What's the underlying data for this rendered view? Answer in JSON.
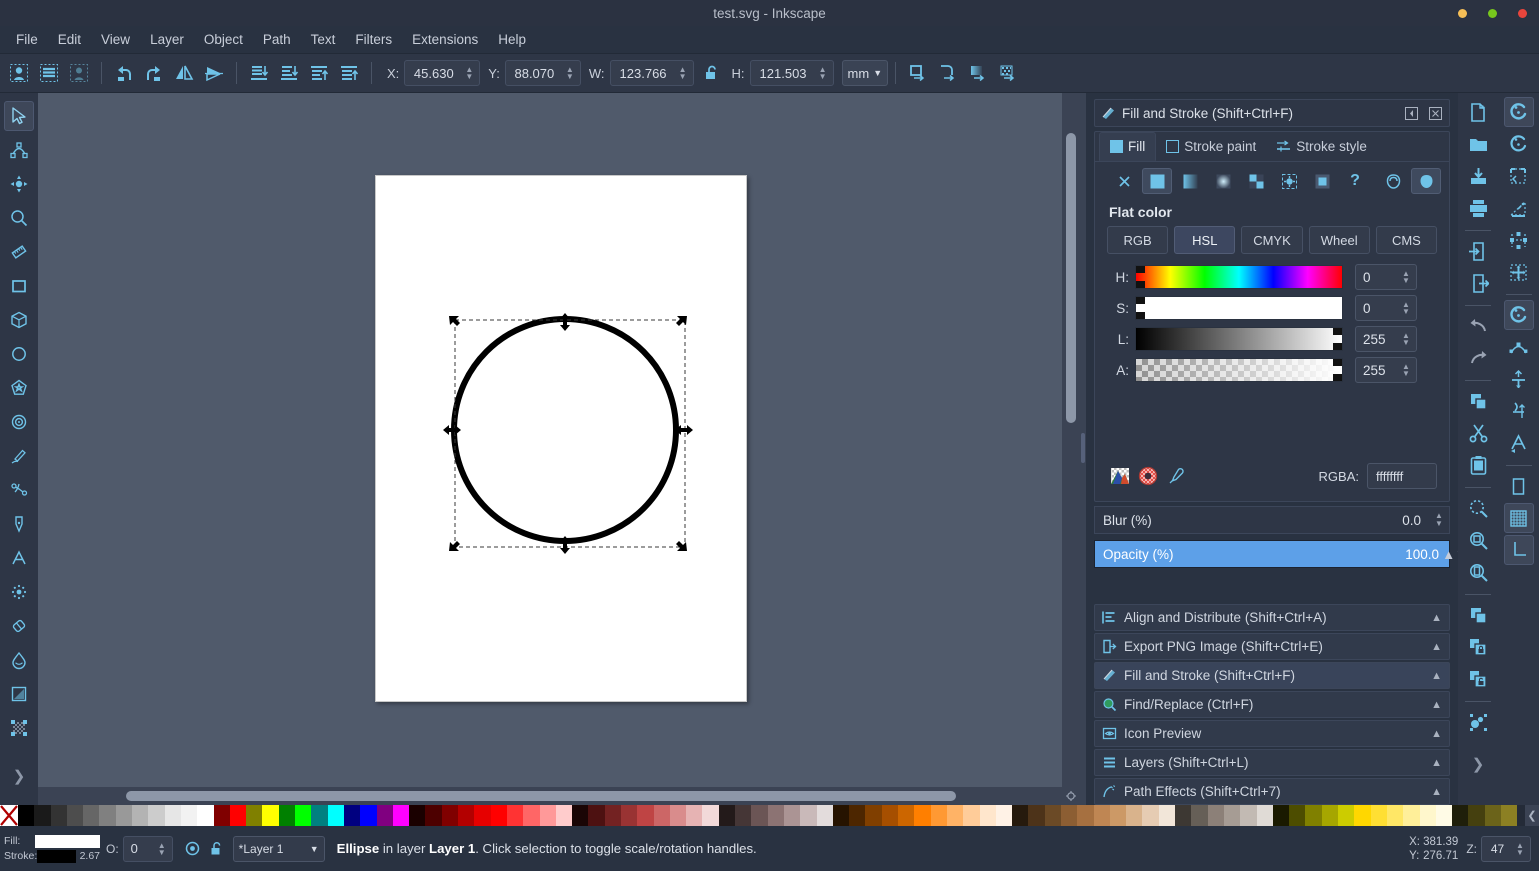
{
  "window": {
    "title": "test.svg - Inkscape",
    "controls": [
      {
        "name": "minimize",
        "color": "#f6bf57"
      },
      {
        "name": "maximize",
        "color": "#78c71d"
      },
      {
        "name": "close",
        "color": "#e8453c"
      }
    ]
  },
  "menubar": [
    "File",
    "Edit",
    "View",
    "Layer",
    "Object",
    "Path",
    "Text",
    "Filters",
    "Extensions",
    "Help"
  ],
  "tooloptions": {
    "buttons": [
      "select-all-icon",
      "select-all-layers-icon",
      "deselect-icon",
      "rotate-ccw-icon",
      "rotate-cw-icon",
      "flip-horizontal-icon",
      "flip-vertical-icon",
      "lower-to-bottom-icon",
      "lower-icon",
      "raise-icon",
      "raise-to-top-icon"
    ],
    "x_label": "X:",
    "x_value": "45.630",
    "y_label": "Y:",
    "y_value": "88.070",
    "w_label": "W:",
    "w_value": "123.766",
    "lock_icon": "unlocked-icon",
    "h_label": "H:",
    "h_value": "121.503",
    "units": "mm",
    "affect_buttons": [
      "scale-stroke-icon",
      "scale-corners-icon",
      "transform-gradients-icon",
      "transform-patterns-icon"
    ]
  },
  "toolbox": [
    {
      "name": "selector-tool",
      "icon": "arrow-cursor-icon",
      "active": true
    },
    {
      "name": "node-tool",
      "icon": "node-editor-icon",
      "active": false
    },
    {
      "name": "tweak-tool",
      "icon": "move-arrows-icon",
      "active": false
    },
    {
      "name": "zoom-tool",
      "icon": "magnifier-icon",
      "active": false
    },
    {
      "name": "measure-tool",
      "icon": "ruler-icon",
      "active": false
    },
    {
      "name": "rectangle-tool",
      "icon": "square-icon",
      "active": false
    },
    {
      "name": "box3d-tool",
      "icon": "cube-icon",
      "active": false
    },
    {
      "name": "ellipse-tool",
      "icon": "circle-icon",
      "active": false
    },
    {
      "name": "star-tool",
      "icon": "star-icon",
      "active": false
    },
    {
      "name": "spiral-tool",
      "icon": "spiral-icon",
      "active": false
    },
    {
      "name": "pencil-tool",
      "icon": "pencil-icon",
      "active": false
    },
    {
      "name": "calligraphy-tool",
      "icon": "calligraphy-icon",
      "active": false
    },
    {
      "name": "pen-tool",
      "icon": "pen-nib-icon",
      "active": false
    },
    {
      "name": "text-tool",
      "icon": "letter-a-icon",
      "active": false
    },
    {
      "name": "spray-tool",
      "icon": "spray-dots-icon",
      "active": false
    },
    {
      "name": "eraser-tool",
      "icon": "eraser-icon",
      "active": false
    },
    {
      "name": "paint-bucket-tool",
      "icon": "droplet-icon",
      "active": false
    },
    {
      "name": "gradient-tool",
      "icon": "gradient-square-icon",
      "active": false
    },
    {
      "name": "mesh-gradient-tool",
      "icon": "mesh-grid-icon",
      "active": false
    },
    {
      "name": "toolbox-overflow",
      "icon": "chevron-right-icon",
      "active": false
    }
  ],
  "canvas": {
    "page_label": "drawing-page",
    "object": "ellipse"
  },
  "dock": {
    "panel": {
      "title": "Fill and Stroke (Shift+Ctrl+F)",
      "collapse_icon": "collapse-icon",
      "close_icon": "close-icon"
    },
    "tabs": [
      {
        "label": "Fill",
        "icon": "fill-square-icon",
        "active": true
      },
      {
        "label": "Stroke paint",
        "icon": "stroke-square-icon",
        "active": false
      },
      {
        "label": "Stroke style",
        "icon": "stroke-style-icon",
        "active": false
      }
    ],
    "paint_types": [
      {
        "name": "no-paint",
        "icon": "x-icon",
        "selected": false
      },
      {
        "name": "flat-color",
        "icon": "flat-square-icon",
        "selected": true
      },
      {
        "name": "linear-gradient",
        "icon": "linear-gradient-icon",
        "selected": false
      },
      {
        "name": "radial-gradient",
        "icon": "radial-gradient-icon",
        "selected": false
      },
      {
        "name": "pattern",
        "icon": "checker-pattern-icon",
        "selected": false
      },
      {
        "name": "swatch",
        "icon": "swatch-icon",
        "selected": false
      },
      {
        "name": "mesh-gradient",
        "icon": "mesh-gradient-icon",
        "selected": false
      },
      {
        "name": "unknown-paint",
        "icon": "question-mark-icon",
        "selected": false
      }
    ],
    "fill_rules": [
      {
        "name": "even-odd-fill-rule",
        "icon": "evenodd-icon",
        "selected": false
      },
      {
        "name": "nonzero-fill-rule",
        "icon": "nonzero-icon",
        "selected": true
      }
    ],
    "flat_color_label": "Flat color",
    "color_modes": [
      {
        "label": "RGB",
        "active": false
      },
      {
        "label": "HSL",
        "active": true
      },
      {
        "label": "CMYK",
        "active": false
      },
      {
        "label": "Wheel",
        "active": false
      },
      {
        "label": "CMS",
        "active": false
      }
    ],
    "sliders": [
      {
        "label": "H:",
        "value": "0",
        "track": "hue"
      },
      {
        "label": "S:",
        "value": "0",
        "track": "saturation"
      },
      {
        "label": "L:",
        "value": "255",
        "track": "lightness"
      },
      {
        "label": "A:",
        "value": "255",
        "track": "alpha"
      }
    ],
    "rgba": {
      "label": "RGBA:",
      "value": "ffffffff",
      "buttons": [
        "color-managed-icon",
        "out-of-gamut-icon",
        "eyedropper-icon"
      ]
    },
    "blur": {
      "label": "Blur (%)",
      "value": "0.0"
    },
    "opacity": {
      "label": "Opacity (%)",
      "value": "100.0"
    },
    "items": [
      {
        "label": "Align and Distribute (Shift+Ctrl+A)",
        "icon": "align-icon",
        "selected": false
      },
      {
        "label": "Export PNG Image (Shift+Ctrl+E)",
        "icon": "export-icon",
        "selected": false
      },
      {
        "label": "Fill and Stroke (Shift+Ctrl+F)",
        "icon": "fill-stroke-icon",
        "selected": true
      },
      {
        "label": "Find/Replace (Ctrl+F)",
        "icon": "find-icon",
        "selected": false
      },
      {
        "label": "Icon Preview",
        "icon": "icon-preview-icon",
        "selected": false
      },
      {
        "label": "Layers (Shift+Ctrl+L)",
        "icon": "layers-icon",
        "selected": false
      },
      {
        "label": "Path Effects  (Shift+Ctrl+7)",
        "icon": "path-effects-icon",
        "selected": false
      }
    ]
  },
  "commandbar_left": [
    {
      "name": "new-document",
      "icon": "new-file-icon"
    },
    {
      "name": "open-document",
      "icon": "folder-icon"
    },
    {
      "name": "save-document",
      "icon": "save-icon"
    },
    {
      "name": "print-document",
      "icon": "printer-icon"
    },
    {
      "name": "import",
      "icon": "import-icon"
    },
    {
      "name": "export",
      "icon": "export-file-icon"
    },
    {
      "name": "undo",
      "icon": "undo-arrow-icon"
    },
    {
      "name": "redo",
      "icon": "redo-arrow-icon"
    },
    {
      "name": "copy",
      "icon": "copy-icon"
    },
    {
      "name": "cut",
      "icon": "scissors-icon"
    },
    {
      "name": "paste",
      "icon": "clipboard-icon"
    },
    {
      "name": "zoom-selection",
      "icon": "zoom-selection-icon"
    },
    {
      "name": "zoom-drawing",
      "icon": "zoom-drawing-icon"
    },
    {
      "name": "zoom-page",
      "icon": "zoom-page-icon"
    },
    {
      "name": "duplicate",
      "icon": "duplicate-icon"
    },
    {
      "name": "group",
      "icon": "group-lock-icon"
    },
    {
      "name": "ungroup",
      "icon": "ungroup-icon"
    },
    {
      "name": "xml-editor",
      "icon": "object-properties-icon"
    },
    {
      "name": "commandbar-overflow",
      "icon": "chevron-right-icon"
    }
  ],
  "commandbar_right": [
    {
      "name": "snap-enable",
      "icon": "snap-icon",
      "active": true
    },
    {
      "name": "snap-bounding-box",
      "icon": "snap-bbox-icon",
      "active": false
    },
    {
      "name": "snap-bbox-corner",
      "icon": "snap-corner-icon",
      "active": false
    },
    {
      "name": "snap-bbox-edge-midpoint",
      "icon": "snap-edge-mid-icon",
      "active": false
    },
    {
      "name": "snap-nodes",
      "icon": "snap-nodes-icon",
      "active": false
    },
    {
      "name": "snap-node-cusp",
      "icon": "snap-cusp-icon",
      "active": false
    },
    {
      "name": "snap-path",
      "icon": "snap-path-icon",
      "active": true
    },
    {
      "name": "snap-path-intersection",
      "icon": "snap-intersection-icon",
      "active": false
    },
    {
      "name": "snap-smooth-node",
      "icon": "snap-smooth-icon",
      "active": false
    },
    {
      "name": "snap-midpoint",
      "icon": "snap-midpoint-icon",
      "active": false
    },
    {
      "name": "snap-object-center",
      "icon": "snap-center-icon",
      "active": false
    },
    {
      "name": "snap-rotation-center",
      "icon": "snap-rotation-icon",
      "active": true
    },
    {
      "name": "snap-grid",
      "icon": "snap-grid-lines-icon",
      "active": false
    },
    {
      "name": "snap-guide",
      "icon": "snap-guide-icon",
      "active": false
    },
    {
      "name": "snap-text-baseline",
      "icon": "snap-text-icon",
      "active": false
    },
    {
      "name": "snap-page-border",
      "icon": "snap-page-icon",
      "active": false
    },
    {
      "name": "snap-grid-toggle",
      "icon": "grid-icon",
      "active": true
    },
    {
      "name": "snap-guides-toggle",
      "icon": "guide-axis-icon",
      "active": true
    }
  ],
  "palette": {
    "none_swatch": "none-color-icon",
    "scroll_left": "chevron-left-icon",
    "scroll_right": "chevron-right-icon",
    "colors": [
      "#000000",
      "#1a1a1a",
      "#333333",
      "#4d4d4d",
      "#666666",
      "#808080",
      "#999999",
      "#b3b3b3",
      "#cccccc",
      "#e6e6e6",
      "#f2f2f2",
      "#ffffff",
      "#800000",
      "#ff0000",
      "#808000",
      "#ffff00",
      "#008000",
      "#00ff00",
      "#008080",
      "#00ffff",
      "#000080",
      "#0000ff",
      "#800080",
      "#ff00ff",
      "#1a0000",
      "#4d0000",
      "#800000",
      "#b30000",
      "#e60000",
      "#ff0000",
      "#ff3333",
      "#ff6666",
      "#ff9999",
      "#ffcccc",
      "#1a0505",
      "#4d1111",
      "#732222",
      "#993333",
      "#bf4444",
      "#cc6666",
      "#d98c8c",
      "#e6b3b3",
      "#f2d9d9",
      "#231a1a",
      "#453636",
      "#6b5555",
      "#8c7373",
      "#ab9494",
      "#c9b9b9",
      "#e3dcdc",
      "#261300",
      "#4d2600",
      "#803f00",
      "#a64f00",
      "#cc6600",
      "#ff7f00",
      "#ff9933",
      "#ffb366",
      "#ffcc99",
      "#ffe6cc",
      "#fff2e6",
      "#261a0d",
      "#4d3319",
      "#6b4a26",
      "#8c5e33",
      "#a67040",
      "#bf8653",
      "#cc9966",
      "#d9b38c",
      "#e6ccb3",
      "#f2e6d9",
      "#3d3833",
      "#665f57",
      "#8c8078",
      "#a69c94",
      "#c2bab3",
      "#e0dbd6",
      "#1a1a00",
      "#4d4d00",
      "#808000",
      "#a6a600",
      "#cccc00",
      "#ffd700",
      "#ffdf33",
      "#ffe766",
      "#ffef99",
      "#fff7cc",
      "#fffbe6",
      "#1f1f0a",
      "#45400f",
      "#6b631a",
      "#8c8023"
    ]
  },
  "statusbar": {
    "fill_label": "Fill:",
    "fill_color": "#ffffff",
    "stroke_label": "Stroke:",
    "stroke_color": "#000000",
    "stroke_width": "2.67",
    "opacity_label": "O:",
    "opacity_value": "0",
    "visibility_icon": "eye-icon",
    "lock_icon": "unlocked-icon",
    "layer_name": "*Layer 1",
    "message_object": "Ellipse",
    "message_mid": " in layer ",
    "message_layer": "Layer 1",
    "message_tail": ". Click selection to toggle scale/rotation handles.",
    "x_label": "X:",
    "x_value": "381.39",
    "y_label": "Y:",
    "y_value": "276.71",
    "z_label": "Z:",
    "z_value": "47"
  }
}
